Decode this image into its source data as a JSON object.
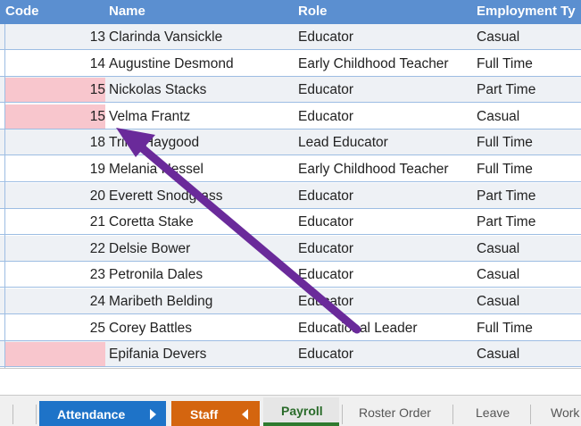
{
  "table": {
    "headers": {
      "code": "Code",
      "name": "Name",
      "role": "Role",
      "employment": "Employment Ty"
    },
    "rows": [
      {
        "code": "13",
        "name": "Clarinda Vansickle",
        "role": "Educator",
        "employment": "Casual",
        "flag": false
      },
      {
        "code": "14",
        "name": "Augustine Desmond",
        "role": "Early Childhood Teacher",
        "employment": "Full Time",
        "flag": false
      },
      {
        "code": "15",
        "name": "Nickolas Stacks",
        "role": "Educator",
        "employment": "Part Time",
        "flag": true
      },
      {
        "code": "15",
        "name": "Velma Frantz",
        "role": "Educator",
        "employment": "Casual",
        "flag": true
      },
      {
        "code": "18",
        "name": "Trina Haygood",
        "role": "Lead Educator",
        "employment": "Full Time",
        "flag": false
      },
      {
        "code": "19",
        "name": "Melania Hessel",
        "role": "Early Childhood Teacher",
        "employment": "Full Time",
        "flag": false
      },
      {
        "code": "20",
        "name": "Everett Snodgrass",
        "role": "Educator",
        "employment": "Part Time",
        "flag": false
      },
      {
        "code": "21",
        "name": "Coretta Stake",
        "role": "Educator",
        "employment": "Part Time",
        "flag": false
      },
      {
        "code": "22",
        "name": "Delsie Bower",
        "role": "Educator",
        "employment": "Casual",
        "flag": false
      },
      {
        "code": "23",
        "name": "Petronila Dales",
        "role": "Educator",
        "employment": "Casual",
        "flag": false
      },
      {
        "code": "24",
        "name": "Maribeth Belding",
        "role": "Educator",
        "employment": "Casual",
        "flag": false
      },
      {
        "code": "25",
        "name": "Corey Battles",
        "role": "Educational Leader",
        "employment": "Full Time",
        "flag": false
      },
      {
        "code": "",
        "name": "Epifania Devers",
        "role": "Educator",
        "employment": "Casual",
        "flag": true
      }
    ]
  },
  "tabs": {
    "attendance": "Attendance",
    "staff": "Staff",
    "payroll": "Payroll",
    "roster_order": "Roster Order",
    "leave": "Leave",
    "work": "Work"
  },
  "colors": {
    "header_bg": "#5b8fd0",
    "flag_bg": "#f8c6cd",
    "attendance_tab": "#1e73c8",
    "staff_tab": "#d4650f",
    "payroll_accent": "#2f7a2f",
    "annotation_arrow": "#6a2a9a"
  },
  "icons": {
    "attendance_tab_icon": "triangle-right-icon",
    "staff_tab_icon": "triangle-left-icon",
    "annotation": "arrow-icon"
  }
}
